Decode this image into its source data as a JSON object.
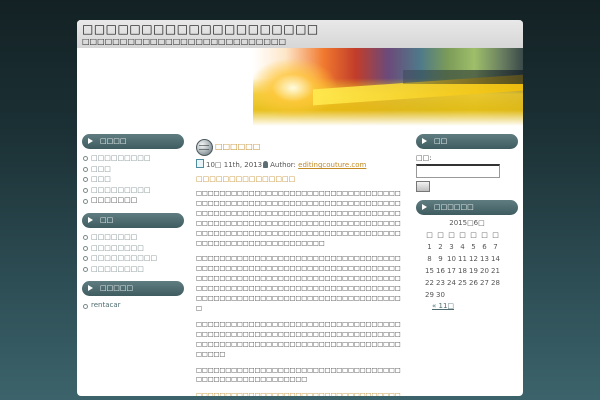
{
  "site": {
    "title": "□□□□□□□□□□□□□□□□□□□□",
    "description": "□□□□□□□□□□□□□□□□□□□□□□□□□□□"
  },
  "left_sidebar": {
    "widgets": [
      {
        "title": "□□□□",
        "items": [
          "□□□□□□□□□",
          "□□□",
          "□□□",
          "□□□□□□□□□",
          "□□□□□□□"
        ]
      },
      {
        "title": "□□",
        "items": [
          "□□□□□□□",
          "□□□□□□□□",
          "□□□□□□□□□□",
          "□□□□□□□□"
        ]
      },
      {
        "title": "□□□□□",
        "items": [
          "rentacar"
        ]
      }
    ]
  },
  "post": {
    "title": "□□□□□□",
    "date": "10□ 11th, 2013",
    "author_label": "Author:",
    "author": "editingcouture.com",
    "lead_link": "□□□□□□□□□□□□□□□",
    "paragraphs": [
      "□□□□□□□□□□□□□□□□□□□□□□□□□□□□□□□□□□□□□□□□□□□□□□□□□□□□□□□□□□□□□□□□□□□□□□□□□□□□□□□□□□□□□□□□□□□□□□□□□□□□□□□□□□□□□□□□□□□□□□□□□□□□□□□□□□□□□□□□□□□□□□□□□□□□□□□□□□□□□□□□□□□□□□□□□□□□□□□□□□□□□□□□□□□□□□□□□□□□□",
      "□□□□□□□□□□□□□□□□□□□□□□□□□□□□□□□□□□□□□□□□□□□□□□□□□□□□□□□□□□□□□□□□□□□□□□□□□□□□□□□□□□□□□□□□□□□□□□□□□□□□□□□□□□□□□□□□□□□□□□□□□□□□□□□□□□□□□□□□□□□□□□□□□□□□□□□□□□□□□□□□□□□□□□□□□□□□□□□□",
      "□□□□□□□□□□□□□□□□□□□□□□□□□□□□□□□□□□□□□□□□□□□□□□□□□□□□□□□□□□□□□□□□□□□□□□□□□□□□□□□□□□□□□□□□□□□□□□□□□□□□□□□□□□□□□□",
      "□□□□□□□□□□□□□□□□□□□□□□□□□□□□□□□□□□□□□□□□□□□□□□□□□□□□□□",
      "□□□□□□□□□□□□□□□□□□□□□□□□□□□□□□□□□□□□□□□□□□□□□□□□□□□□"
    ]
  },
  "right_sidebar": {
    "search": {
      "title": "□□",
      "label": "□□:",
      "value": ""
    },
    "calendar": {
      "title": "□□□□□□",
      "caption": "2015□6□",
      "weekdays": [
        "□",
        "□",
        "□",
        "□",
        "□",
        "□",
        "□"
      ],
      "weeks": [
        [
          "1",
          "2",
          "3",
          "4",
          "5",
          "6",
          "7"
        ],
        [
          "8",
          "9",
          "10",
          "11",
          "12",
          "13",
          "14"
        ],
        [
          "15",
          "16",
          "17",
          "18",
          "19",
          "20",
          "21"
        ],
        [
          "22",
          "23",
          "24",
          "25",
          "26",
          "27",
          "28"
        ],
        [
          "29",
          "30",
          "",
          "",
          "",
          "",
          ""
        ]
      ],
      "prev_link": "« 11□"
    }
  },
  "colors": {
    "accent_link": "#c28a26",
    "widget_header": "#4a676b",
    "background_dark": "#132124"
  }
}
